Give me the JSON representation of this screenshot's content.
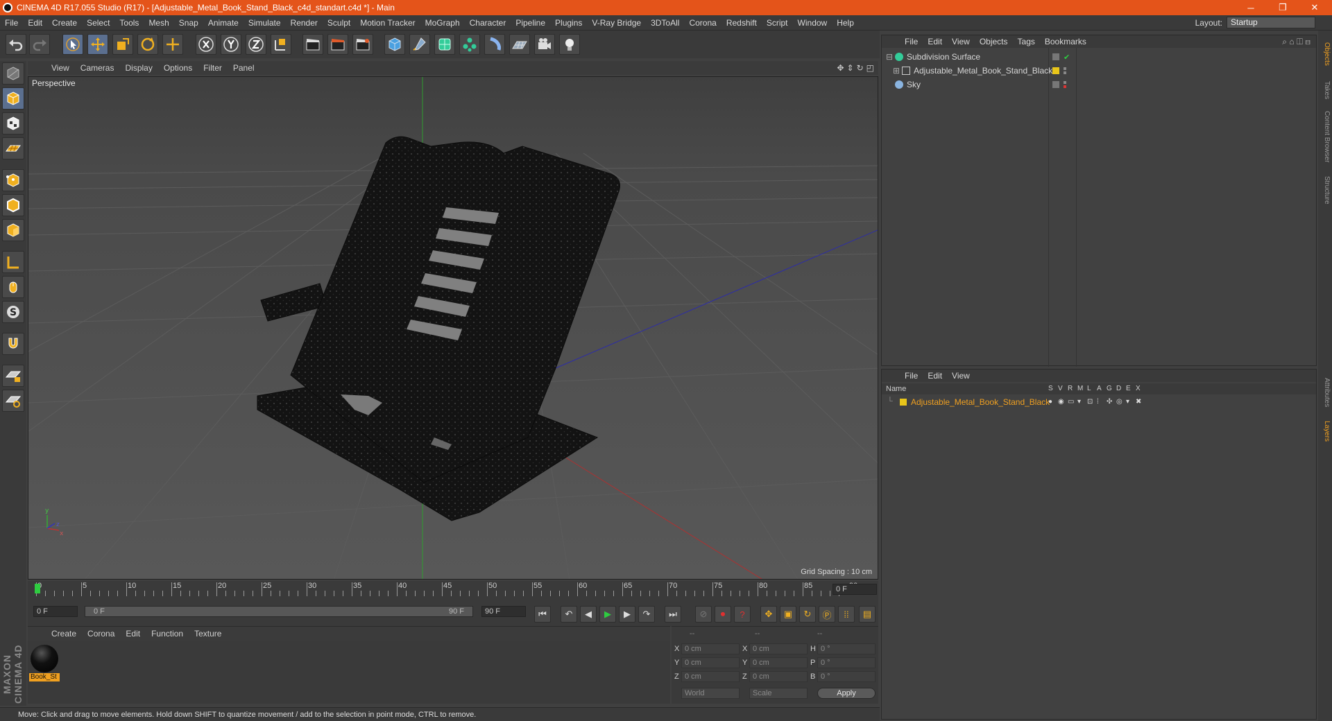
{
  "window": {
    "title": "CINEMA 4D R17.055 Studio (R17) - [Adjustable_Metal_Book_Stand_Black_c4d_standart.c4d *] - Main",
    "minimize": "─",
    "restore": "❐",
    "close": "✕"
  },
  "menubar": {
    "items": [
      "File",
      "Edit",
      "Create",
      "Select",
      "Tools",
      "Mesh",
      "Snap",
      "Animate",
      "Simulate",
      "Render",
      "Sculpt",
      "Motion Tracker",
      "MoGraph",
      "Character",
      "Pipeline",
      "Plugins",
      "V-Ray Bridge",
      "3DToAll",
      "Corona",
      "Redshift",
      "Script",
      "Window",
      "Help"
    ],
    "layout_label": "Layout:",
    "layout_value": "Startup"
  },
  "viewport": {
    "menu": [
      "View",
      "Cameras",
      "Display",
      "Options",
      "Filter",
      "Panel"
    ],
    "label": "Perspective",
    "grid_spacing": "Grid Spacing : 10 cm"
  },
  "timeline": {
    "ticks": [
      "0",
      "5",
      "10",
      "15",
      "20",
      "25",
      "30",
      "35",
      "40",
      "45",
      "50",
      "55",
      "60",
      "65",
      "70",
      "75",
      "80",
      "85",
      "90"
    ],
    "current_frame": "0 F",
    "start_field": "0 F",
    "range_start": "0 F",
    "range_end": "90 F",
    "end_field": "90 F"
  },
  "material_manager": {
    "menu": [
      "Create",
      "Corona",
      "Edit",
      "Function",
      "Texture"
    ],
    "material_name": "Book_St"
  },
  "attributes": {
    "header": [
      "--",
      "--",
      "--"
    ],
    "rows": [
      {
        "a": "X",
        "v1": "0 cm",
        "b": "X",
        "v2": "0 cm",
        "c": "H",
        "v3": "0 °"
      },
      {
        "a": "Y",
        "v1": "0 cm",
        "b": "Y",
        "v2": "0 cm",
        "c": "P",
        "v3": "0 °"
      },
      {
        "a": "Z",
        "v1": "0 cm",
        "b": "Z",
        "v2": "0 cm",
        "c": "B",
        "v3": "0 °"
      }
    ],
    "coord_mode": "World",
    "size_mode": "Scale",
    "apply": "Apply"
  },
  "status": "Move: Click and drag to move elements. Hold down SHIFT to quantize movement / add to the selection in point mode, CTRL to remove.",
  "object_manager": {
    "menu": [
      "File",
      "Edit",
      "View",
      "Objects",
      "Tags",
      "Bookmarks"
    ],
    "objects": [
      {
        "name": "Subdivision Surface"
      },
      {
        "name": "Adjustable_Metal_Book_Stand_Black"
      },
      {
        "name": "Sky"
      }
    ]
  },
  "layer_manager": {
    "menu": [
      "File",
      "Edit",
      "View"
    ],
    "name_header": "Name",
    "columns": [
      "S",
      "V",
      "R",
      "M",
      "L",
      "A",
      "G",
      "D",
      "E",
      "X"
    ],
    "layer_name": "Adjustable_Metal_Book_Stand_Black",
    "layer_color": "#e8c51a"
  },
  "side_tabs": [
    "Objects",
    "Takes",
    "Content Browser",
    "Structure",
    "Attributes",
    "Layers"
  ],
  "brand": "MAXON CINEMA 4D"
}
